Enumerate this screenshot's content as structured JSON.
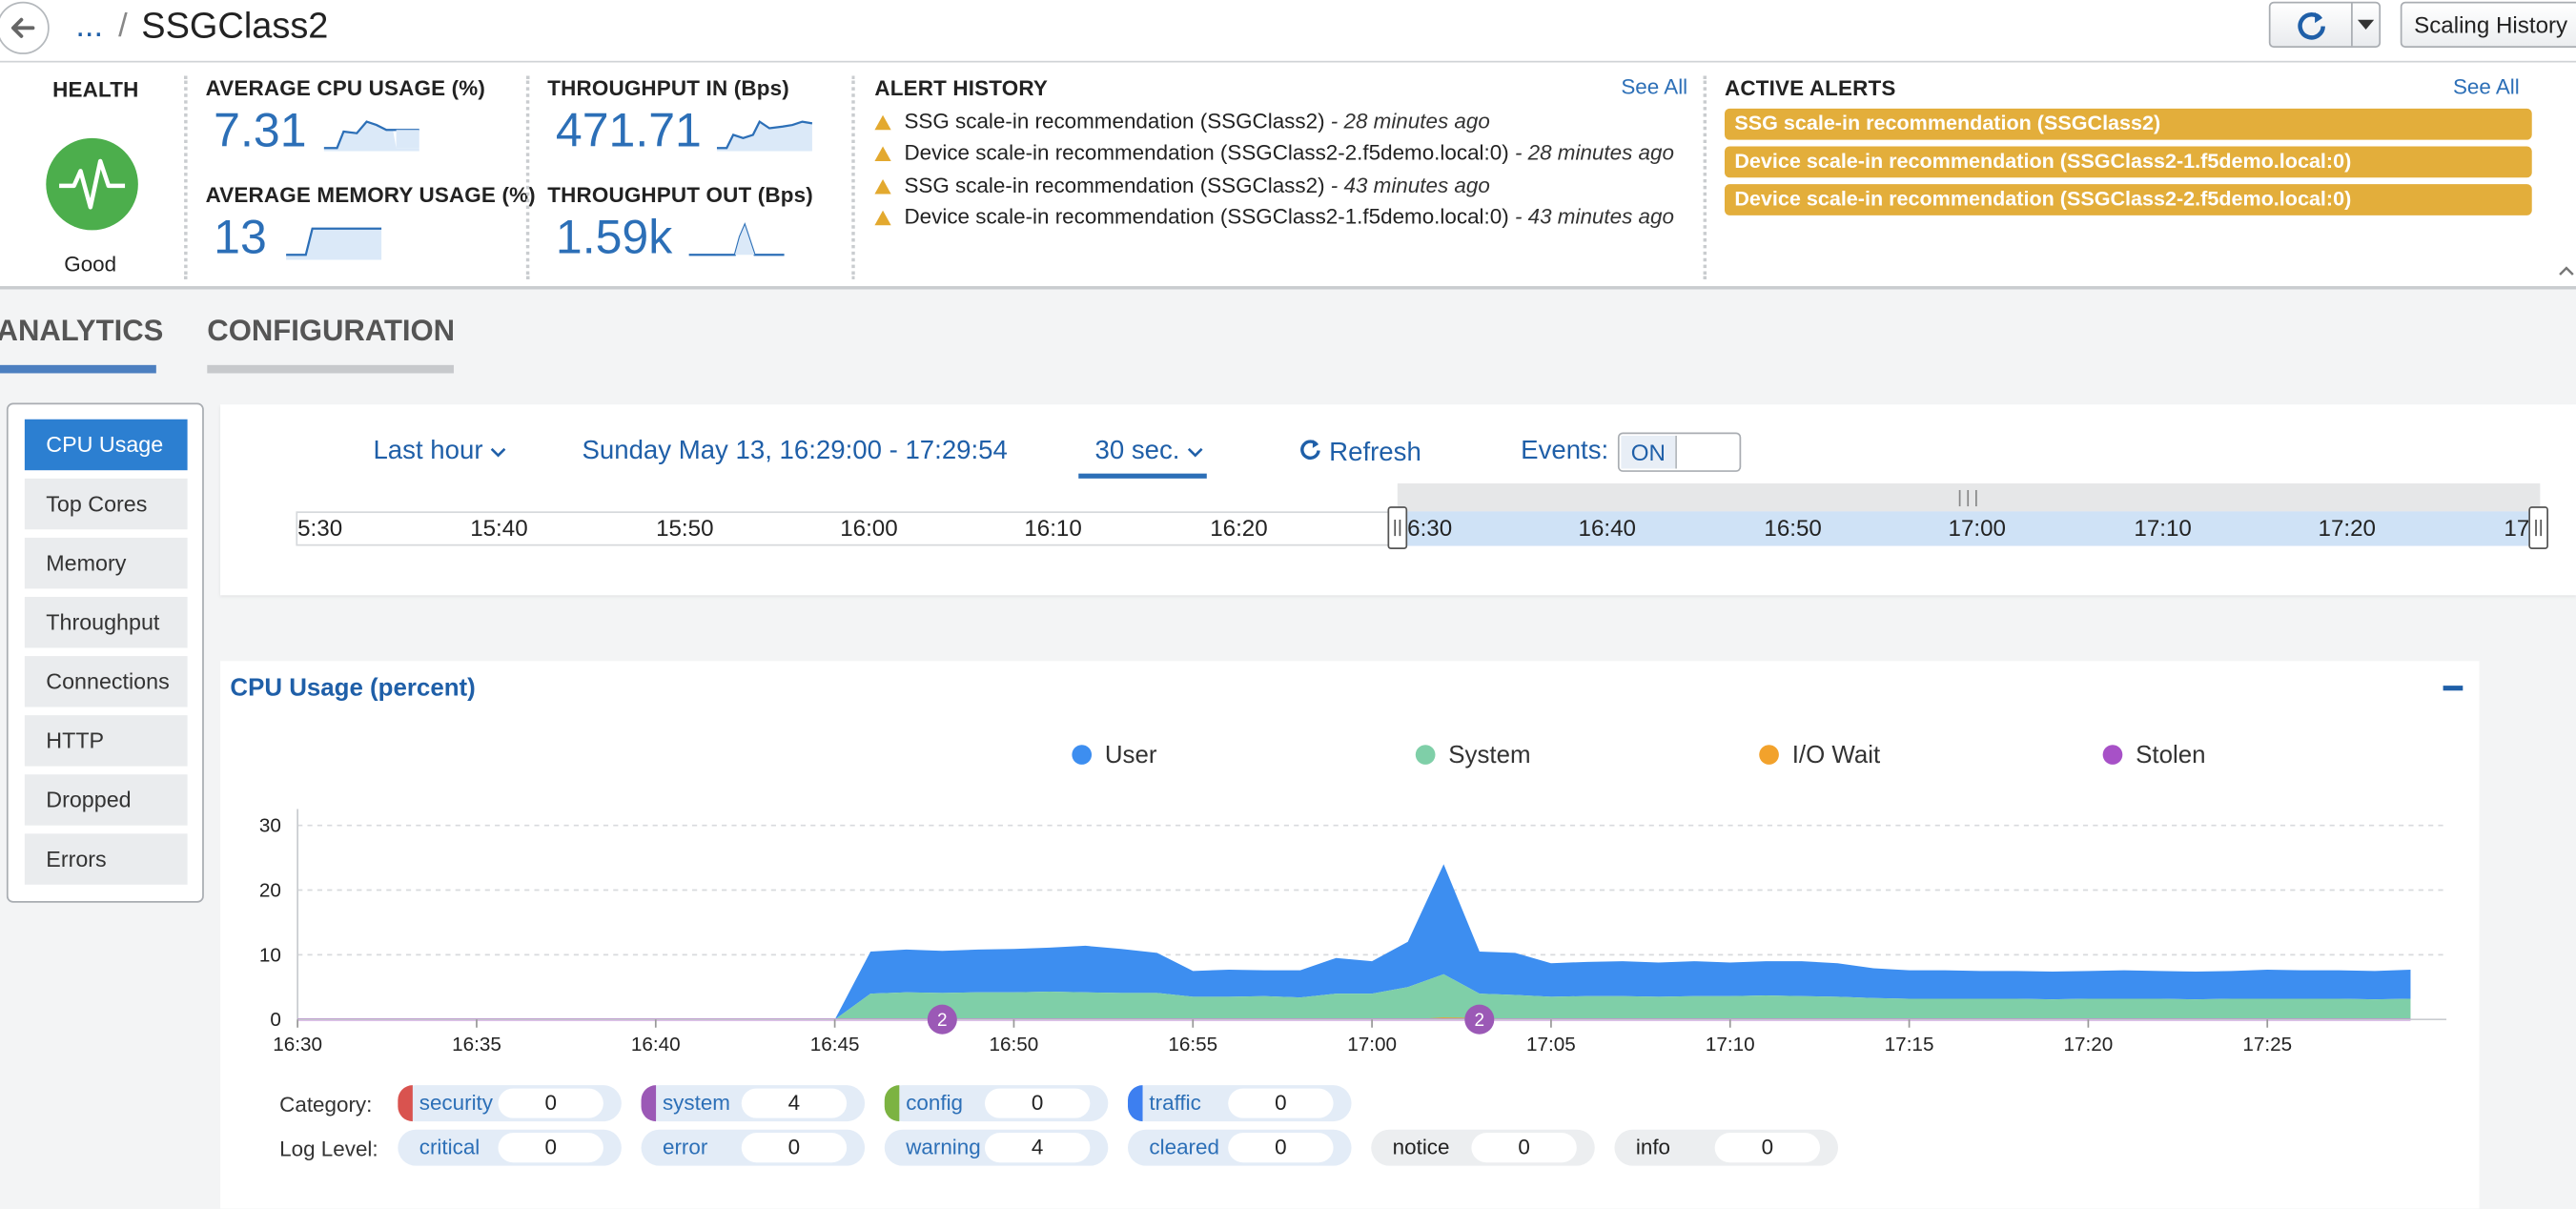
{
  "topbar": {
    "breadcrumb_ellipsis": "...",
    "breadcrumb_sep": "/",
    "title": "SSGClass2",
    "scaling_history_label": "Scaling History"
  },
  "summary": {
    "health": {
      "label": "HEALTH",
      "status": "Good",
      "color": "#4cae4c"
    },
    "cpu": {
      "label": "AVERAGE CPU USAGE (%)",
      "value": "7.31"
    },
    "memory": {
      "label": "AVERAGE MEMORY USAGE (%)",
      "value": "13"
    },
    "throughput_in": {
      "label": "THROUGHPUT IN (Bps)",
      "value": "471.71"
    },
    "throughput_out": {
      "label": "THROUGHPUT OUT (Bps)",
      "value": "1.59k"
    },
    "alert_history": {
      "label": "ALERT HISTORY",
      "see_all": "See All",
      "items": [
        {
          "text": "SSG scale-in recommendation (SSGClass2)",
          "time": "- 28 minutes ago"
        },
        {
          "text": "Device scale-in recommendation (SSGClass2-2.f5demo.local:0)",
          "time": "- 28 minutes ago"
        },
        {
          "text": "SSG scale-in recommendation (SSGClass2)",
          "time": "- 43 minutes ago"
        },
        {
          "text": "Device scale-in recommendation (SSGClass2-1.f5demo.local:0)",
          "time": "- 43 minutes ago"
        }
      ]
    },
    "active_alerts": {
      "label": "ACTIVE ALERTS",
      "see_all": "See All",
      "items": [
        "SSG scale-in recommendation (SSGClass2)",
        "Device scale-in recommendation (SSGClass2-1.f5demo.local:0)",
        "Device scale-in recommendation (SSGClass2-2.f5demo.local:0)"
      ],
      "color": "#e3ae3b"
    }
  },
  "tabs": {
    "analytics": "ANALYTICS",
    "configuration": "CONFIGURATION"
  },
  "sidebar": {
    "items": [
      {
        "label": "CPU Usage",
        "active": true
      },
      {
        "label": "Top Cores"
      },
      {
        "label": "Memory"
      },
      {
        "label": "Throughput"
      },
      {
        "label": "Connections"
      },
      {
        "label": "HTTP"
      },
      {
        "label": "Dropped"
      },
      {
        "label": "Errors"
      }
    ]
  },
  "time_controls": {
    "range": "Last hour",
    "date_range": "Sunday May 13, 16:29:00 - 17:29:54",
    "interval": "30 sec.",
    "refresh": "Refresh",
    "events_label": "Events:",
    "events_state": "ON",
    "timeline_ticks": [
      "5:30",
      "15:40",
      "15:50",
      "16:00",
      "16:10",
      "16:20",
      "6:30",
      "16:40",
      "16:50",
      "17:00",
      "17:10",
      "17:20",
      "17:"
    ]
  },
  "chart_panel": {
    "title": "CPU Usage (percent)"
  },
  "chart_data": {
    "type": "area",
    "x": [
      "16:30",
      "16:31",
      "16:32",
      "16:33",
      "16:34",
      "16:35",
      "16:36",
      "16:37",
      "16:38",
      "16:39",
      "16:40",
      "16:41",
      "16:42",
      "16:43",
      "16:44",
      "16:45",
      "16:46",
      "16:47",
      "16:48",
      "16:49",
      "16:50",
      "16:51",
      "16:52",
      "16:53",
      "16:54",
      "16:55",
      "16:56",
      "16:57",
      "16:58",
      "16:59",
      "17:00",
      "17:01",
      "17:02",
      "17:03",
      "17:04",
      "17:05",
      "17:06",
      "17:07",
      "17:08",
      "17:09",
      "17:10",
      "17:11",
      "17:12",
      "17:13",
      "17:14",
      "17:15",
      "17:16",
      "17:17",
      "17:18",
      "17:19",
      "17:20",
      "17:21",
      "17:22",
      "17:23",
      "17:24",
      "17:25",
      "17:26",
      "17:27",
      "17:28",
      "17:29"
    ],
    "x_ticks": [
      "16:30",
      "16:35",
      "16:40",
      "16:45",
      "16:50",
      "16:55",
      "17:00",
      "17:05",
      "17:10",
      "17:15",
      "17:20",
      "17:25"
    ],
    "ylim": [
      0,
      30
    ],
    "y_ticks": [
      0,
      10,
      20,
      30
    ],
    "grid": true,
    "legend_position": "top",
    "series": [
      {
        "name": "User",
        "color": "#3d8ef0",
        "values": [
          0,
          0,
          0,
          0,
          0,
          0,
          0,
          0,
          0,
          0,
          0,
          0,
          0,
          0,
          0,
          0,
          6.5,
          6.6,
          6.5,
          6.6,
          6.7,
          6.8,
          7.2,
          6.8,
          6.2,
          4,
          4.2,
          4,
          4.2,
          5.5,
          5,
          7,
          17,
          6.5,
          6.5,
          5.2,
          5.3,
          5.4,
          5.3,
          5.4,
          5.2,
          5.3,
          5.4,
          5.2,
          4.6,
          4.4,
          4.4,
          4.3,
          4.3,
          4.3,
          4.3,
          4.4,
          4.3,
          4.3,
          4.3,
          4.5,
          4.4,
          4.4,
          4.4,
          4.5
        ]
      },
      {
        "name": "System",
        "color": "#7fcfa8",
        "values": [
          0,
          0,
          0,
          0,
          0,
          0,
          0,
          0,
          0,
          0,
          0,
          0,
          0,
          0,
          0,
          0,
          4,
          4.2,
          4.1,
          4.2,
          4.2,
          4.3,
          4.2,
          4.1,
          4.1,
          3.5,
          3.5,
          3.6,
          3.4,
          4,
          4,
          5,
          7,
          4,
          3.8,
          3.5,
          3.6,
          3.6,
          3.5,
          3.6,
          3.6,
          3.7,
          3.6,
          3.5,
          3.3,
          3.2,
          3.2,
          3.2,
          3.2,
          3.1,
          3.2,
          3.2,
          3.2,
          3.1,
          3.2,
          3.2,
          3.2,
          3.2,
          3.1,
          3.2
        ]
      },
      {
        "name": "I/O Wait",
        "color": "#f2a22c",
        "values": [
          0,
          0,
          0,
          0,
          0,
          0,
          0,
          0,
          0,
          0,
          0,
          0,
          0,
          0,
          0,
          0,
          0,
          0,
          0,
          0,
          0,
          0,
          0,
          0,
          0,
          0,
          0,
          0,
          0,
          0,
          0,
          0,
          0.3,
          0.2,
          0,
          0,
          0,
          0,
          0,
          0,
          0,
          0,
          0,
          0,
          0,
          0,
          0,
          0,
          0,
          0,
          0,
          0,
          0,
          0,
          0,
          0,
          0,
          0,
          0,
          0
        ]
      },
      {
        "name": "Stolen",
        "color": "#a751c7",
        "values": [
          0,
          0,
          0,
          0,
          0,
          0,
          0,
          0,
          0,
          0,
          0,
          0,
          0,
          0,
          0,
          0,
          0,
          0,
          0,
          0,
          0,
          0,
          0,
          0,
          0,
          0,
          0,
          0,
          0,
          0,
          0,
          0,
          0,
          0,
          0,
          0,
          0,
          0,
          0,
          0,
          0,
          0,
          0,
          0,
          0,
          0,
          0,
          0,
          0,
          0,
          0,
          0,
          0,
          0,
          0,
          0,
          0,
          0,
          0,
          0
        ]
      }
    ],
    "event_markers": [
      {
        "x": "16:48",
        "label": "2",
        "color": "#9b59b6"
      },
      {
        "x": "17:03",
        "label": "2",
        "color": "#9b59b6"
      }
    ]
  },
  "filters": {
    "category_label": "Category:",
    "loglevel_label": "Log Level:",
    "categories": [
      {
        "name": "security",
        "count": "0",
        "color": "#d9534f"
      },
      {
        "name": "system",
        "count": "4",
        "color": "#9b59b6"
      },
      {
        "name": "config",
        "count": "0",
        "color": "#7cb342"
      },
      {
        "name": "traffic",
        "count": "0",
        "color": "#3d7ff0"
      }
    ],
    "log_levels": [
      {
        "name": "critical",
        "count": "0"
      },
      {
        "name": "error",
        "count": "0"
      },
      {
        "name": "warning",
        "count": "4"
      },
      {
        "name": "cleared",
        "count": "0"
      },
      {
        "name": "notice",
        "count": "0"
      },
      {
        "name": "info",
        "count": "0"
      }
    ]
  }
}
